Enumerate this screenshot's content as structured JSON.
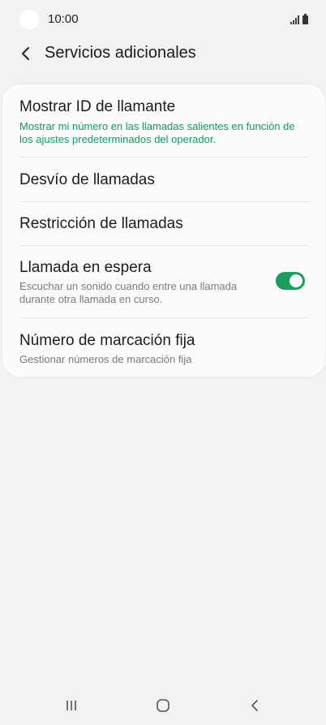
{
  "status_bar": {
    "time": "10:00",
    "icons": [
      "camera-dot",
      "signal-icon",
      "battery-icon"
    ]
  },
  "header": {
    "back_icon": "chevron-left-icon",
    "title": "Servicios adicionales"
  },
  "settings": {
    "items": [
      {
        "title": "Mostrar ID de llamante",
        "subtitle": "Mostrar mi número en las llamadas salientes en función de los ajustes predeterminados del operador."
      },
      {
        "title": "Desvío de llamadas"
      },
      {
        "title": "Restricción de llamadas"
      },
      {
        "title": "Llamada en espera",
        "subtitle": "Escuchar un sonido cuando entre una llamada durante otra llamada en curso.",
        "toggle_on": true
      },
      {
        "title": "Número de marcación fija",
        "subtitle": "Gestionar números de marcación fija"
      }
    ]
  },
  "colors": {
    "accent": "#0f9e5a",
    "toggle": "#1a9e5c",
    "background": "#f2f2f2",
    "card": "#fcfcfc"
  },
  "nav_bar": {
    "icons": [
      "recent-apps-icon",
      "home-icon",
      "back-icon"
    ]
  }
}
